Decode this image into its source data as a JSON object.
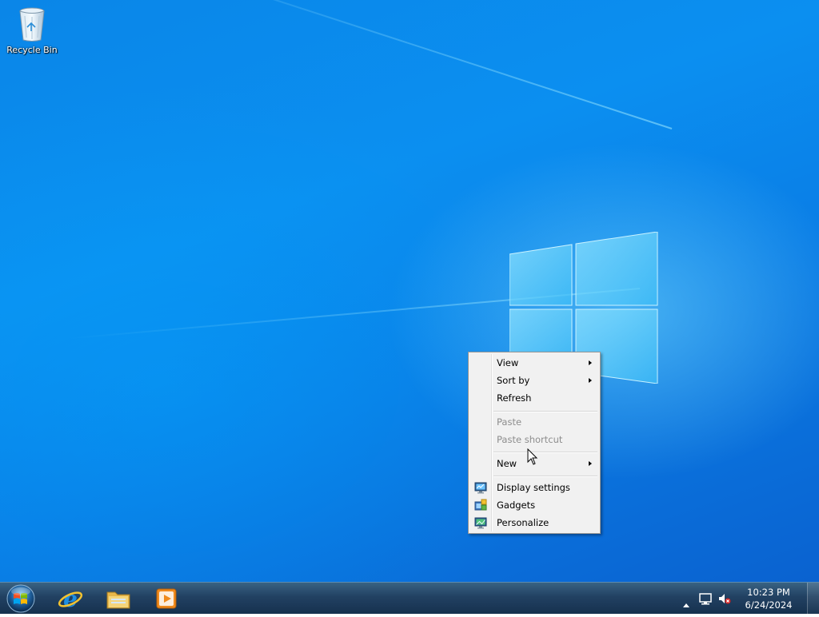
{
  "desktop": {
    "icons": [
      {
        "label": "Recycle Bin",
        "icon": "recycle-bin-icon"
      }
    ]
  },
  "context_menu": {
    "items": [
      {
        "label": "View",
        "submenu": true,
        "enabled": true
      },
      {
        "label": "Sort by",
        "submenu": true,
        "enabled": true
      },
      {
        "label": "Refresh",
        "submenu": false,
        "enabled": true
      },
      {
        "label": "Paste",
        "submenu": false,
        "enabled": false
      },
      {
        "label": "Paste shortcut",
        "submenu": false,
        "enabled": false
      },
      {
        "label": "New",
        "submenu": true,
        "enabled": true
      },
      {
        "label": "Display settings",
        "submenu": false,
        "enabled": true,
        "icon": "display-settings-icon"
      },
      {
        "label": "Gadgets",
        "submenu": false,
        "enabled": true,
        "icon": "gadgets-icon"
      },
      {
        "label": "Personalize",
        "submenu": false,
        "enabled": true,
        "icon": "personalize-icon"
      }
    ]
  },
  "taskbar": {
    "pinned": [
      {
        "name": "internet-explorer",
        "icon": "internet-explorer-icon"
      },
      {
        "name": "file-explorer",
        "icon": "folder-icon"
      },
      {
        "name": "media-player",
        "icon": "media-player-icon"
      }
    ],
    "tray": {
      "clock_time": "10:23 PM",
      "clock_date": "6/24/2024",
      "icons": [
        "show-hidden-icons-arrow",
        "network-icon",
        "volume-muted-icon"
      ]
    }
  },
  "colors": {
    "desktop_blue": "#0a86e8",
    "menu_background": "#f1f1f1",
    "disabled_text": "#8d8d8d"
  }
}
